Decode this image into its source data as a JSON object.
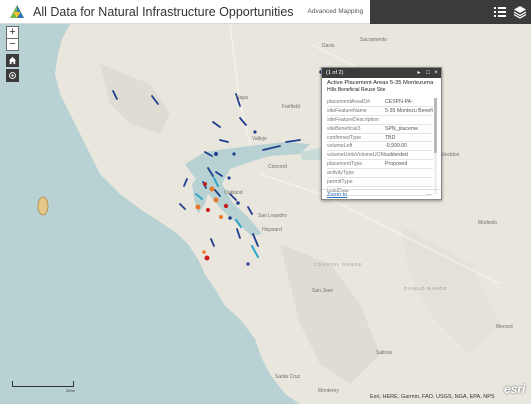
{
  "header": {
    "title": "All Data for Natural Infrastructure Opportunities",
    "subtitle": "Advanced Mapping",
    "logo_icon": "app-logo-triangle",
    "actions": [
      "list-icon",
      "layers-icon"
    ]
  },
  "controls": {
    "zoom_in": "+",
    "zoom_out": "−",
    "home_icon": "home-icon",
    "locate_icon": "locate-icon"
  },
  "popup": {
    "counter": "(1 of 2)",
    "title": "Active Placement Areas 5-35 Montezuma",
    "subtitle": "Hills Beneficial Reuse Site",
    "rows": [
      {
        "key": "placementAreaID#",
        "value": "CESPN-PA-"
      },
      {
        "key": "siteFeatureName",
        "value": "5-35 Montezu Beneficial Re"
      },
      {
        "key": "siteFeatureDescription",
        "value": ""
      },
      {
        "key": "siteBeneficial3",
        "value": "SPN_placeme"
      },
      {
        "key": "confirmedType",
        "value": "TBD"
      },
      {
        "key": "volumeLeft",
        "value": "-9,999.00"
      },
      {
        "key": "volumeUnitsVolumeUOM",
        "value": "sublerded"
      },
      {
        "key": "placementType",
        "value": "Proposed"
      },
      {
        "key": "activityType",
        "value": ""
      },
      {
        "key": "permitType",
        "value": ""
      },
      {
        "key": "buildDate",
        "value": ""
      },
      {
        "key": "dateLastAccessed",
        "value": ""
      }
    ],
    "zoom_to": "Zoom to",
    "more": "…"
  },
  "map_labels": [
    {
      "text": "Napa",
      "cls": ""
    },
    {
      "text": "Sacramento",
      "cls": ""
    },
    {
      "text": "Davis",
      "cls": ""
    },
    {
      "text": "Fairfield",
      "cls": ""
    },
    {
      "text": "Vallejo",
      "cls": ""
    },
    {
      "text": "Concord",
      "cls": ""
    },
    {
      "text": "Oakland",
      "cls": ""
    },
    {
      "text": "San Leandro",
      "cls": ""
    },
    {
      "text": "Hayward",
      "cls": ""
    },
    {
      "text": "San Jose",
      "cls": ""
    },
    {
      "text": "Santa Cruz",
      "cls": ""
    },
    {
      "text": "Stockton",
      "cls": ""
    },
    {
      "text": "Modesto",
      "cls": ""
    },
    {
      "text": "Merced",
      "cls": ""
    },
    {
      "text": "Salinas",
      "cls": ""
    },
    {
      "text": "Monterey",
      "cls": ""
    },
    {
      "text": "COASTAL RANGE",
      "cls": "caps"
    },
    {
      "text": "DIABLO RANGE",
      "cls": "caps"
    }
  ],
  "scale": {
    "label": "20mi"
  },
  "attribution": "Esri, HERE, Garmin, FAO, USGS, NGA, EPA, NPS",
  "esri_logo": "esri",
  "colors": {
    "water": "#b5d0d0",
    "land": "#e8e4dc",
    "header_dark": "#3b3b3b",
    "feature_line": "#1f3f8f",
    "feature_orange": "#e8792b",
    "feature_red": "#c81e1e",
    "link": "#2a6ebb"
  }
}
